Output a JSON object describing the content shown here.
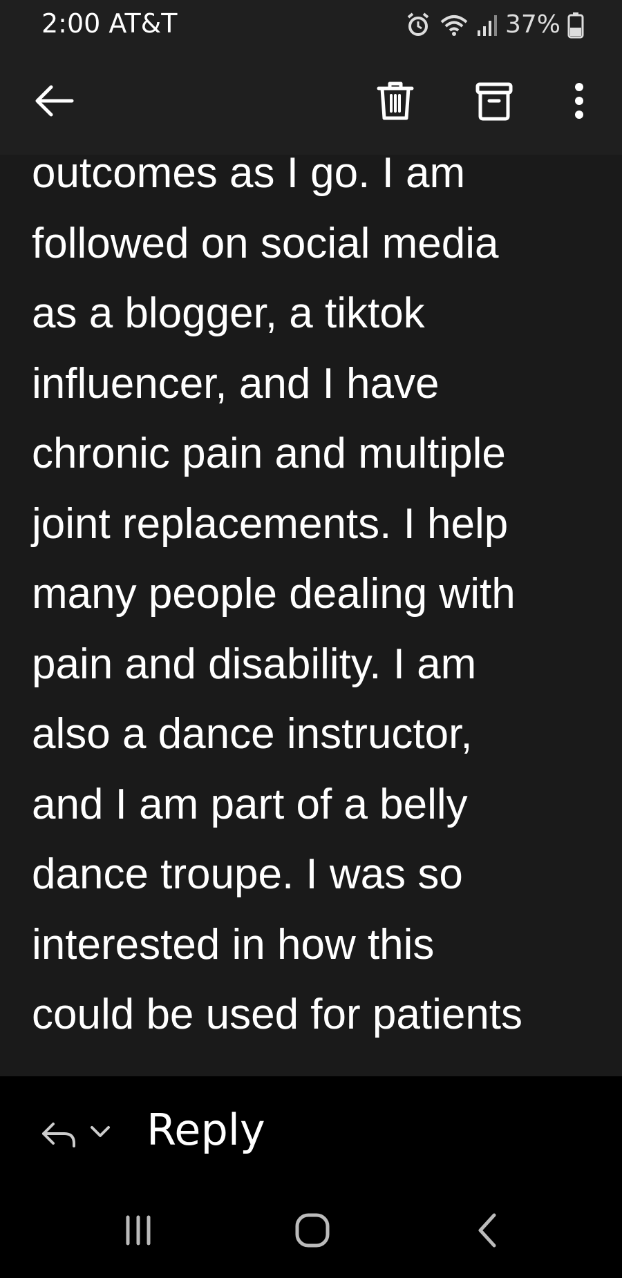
{
  "status_bar": {
    "time_carrier": "2:00 AT&T",
    "battery_percent": "37%",
    "icons": [
      "alarm-icon",
      "wifi-icon",
      "signal-icon",
      "battery-icon"
    ]
  },
  "toolbar": {
    "back_icon": "arrow-left-icon",
    "delete_icon": "trash-icon",
    "archive_icon": "archive-icon",
    "more_icon": "more-vertical-icon"
  },
  "message": {
    "body_lines": "outcomes as I go. I am\nfollowed on social media\nas a blogger, a tiktok\ninfluencer, and I have\nchronic pain and multiple\njoint replacements. I help\nmany people dealing with\npain and disability. I am\nalso a dance instructor,\nand I am part of a belly\ndance troupe. I was so\ninterested in how this\ncould be used for patients"
  },
  "reply_bar": {
    "reply_label": "Reply",
    "reply_icon": "reply-icon",
    "chevron_icon": "chevron-down-icon"
  },
  "nav_bar": {
    "icons": [
      "recents-icon",
      "home-icon",
      "back-chevron-icon"
    ]
  },
  "colors": {
    "bar_bg": "#1f1f1f",
    "content_bg": "#1a1a1a",
    "bottom_bg": "#000000",
    "text": "#ffffff"
  }
}
